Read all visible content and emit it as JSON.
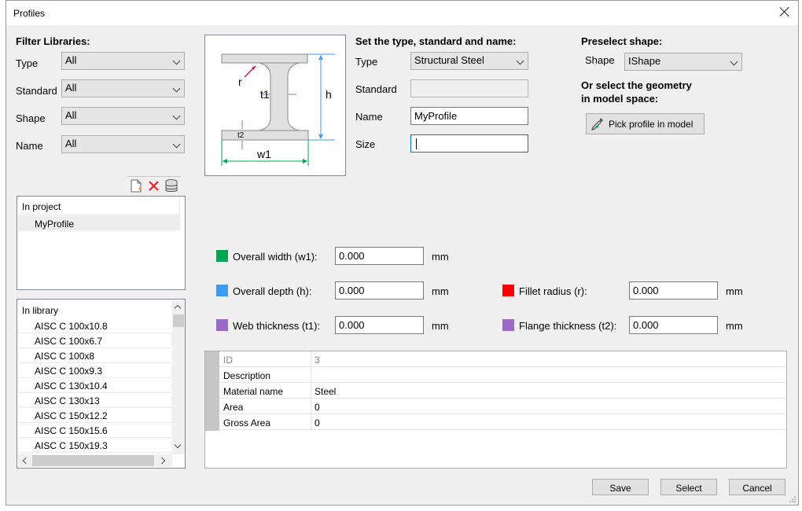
{
  "window": {
    "title": "Profiles"
  },
  "filter": {
    "heading": "Filter Libraries:",
    "fields": [
      {
        "label": "Type",
        "value": "All"
      },
      {
        "label": "Standard",
        "value": "All"
      },
      {
        "label": "Shape",
        "value": "All"
      },
      {
        "label": "Name",
        "value": "All"
      }
    ]
  },
  "lists": {
    "project_header": "In project",
    "project_items": [
      "MyProfile"
    ],
    "library_header": "In library",
    "library_items": [
      "AISC C 100x10.8",
      "AISC C 100x6.7",
      "AISC C 100x8",
      "AISC C 100x9.3",
      "AISC C 130x10.4",
      "AISC C 130x13",
      "AISC C 150x12.2",
      "AISC C 150x15.6",
      "AISC C 150x19.3"
    ]
  },
  "diagram": {
    "labels": {
      "r": "r",
      "t1": "t1",
      "h": "h",
      "t2": "t2",
      "w1": "w1"
    }
  },
  "settype": {
    "heading": "Set the type, standard and name:",
    "type_label": "Type",
    "type_value": "Structural Steel",
    "standard_label": "Standard",
    "standard_value": "",
    "name_label": "Name",
    "name_value": "MyProfile",
    "size_label": "Size",
    "size_value": ""
  },
  "preselect": {
    "heading": "Preselect shape:",
    "shape_label": "Shape",
    "shape_value": "IShape",
    "geometry_line1": "Or select the geometry",
    "geometry_line2": "in model space:",
    "pick_button": "Pick profile in model"
  },
  "dimensions": [
    {
      "label": "Overall width (w1):",
      "value": "0.000",
      "unit": "mm",
      "color": "#00a651"
    },
    {
      "label": "Overall depth (h):",
      "value": "0.000",
      "unit": "mm",
      "color": "#3d9bf0"
    },
    {
      "label": "Web thickness (t1):",
      "value": "0.000",
      "unit": "mm",
      "color": "#9b6ac9"
    },
    {
      "label": "Fillet radius (r):",
      "value": "0.000",
      "unit": "mm",
      "color": "#ff0000"
    },
    {
      "label": "Flange thickness (t2):",
      "value": "0.000",
      "unit": "mm",
      "color": "#9b6ac9"
    }
  ],
  "properties": [
    {
      "key": "ID",
      "value": "3"
    },
    {
      "key": "Description",
      "value": ""
    },
    {
      "key": "Material name",
      "value": "Steel"
    },
    {
      "key": "Area",
      "value": "0"
    },
    {
      "key": "Gross Area",
      "value": "0"
    }
  ],
  "buttons": {
    "save": "Save",
    "select": "Select",
    "cancel": "Cancel"
  },
  "icons": {
    "new": "new-file-icon",
    "delete": "delete-icon",
    "database": "database-icon",
    "pick": "eyedropper-icon"
  }
}
